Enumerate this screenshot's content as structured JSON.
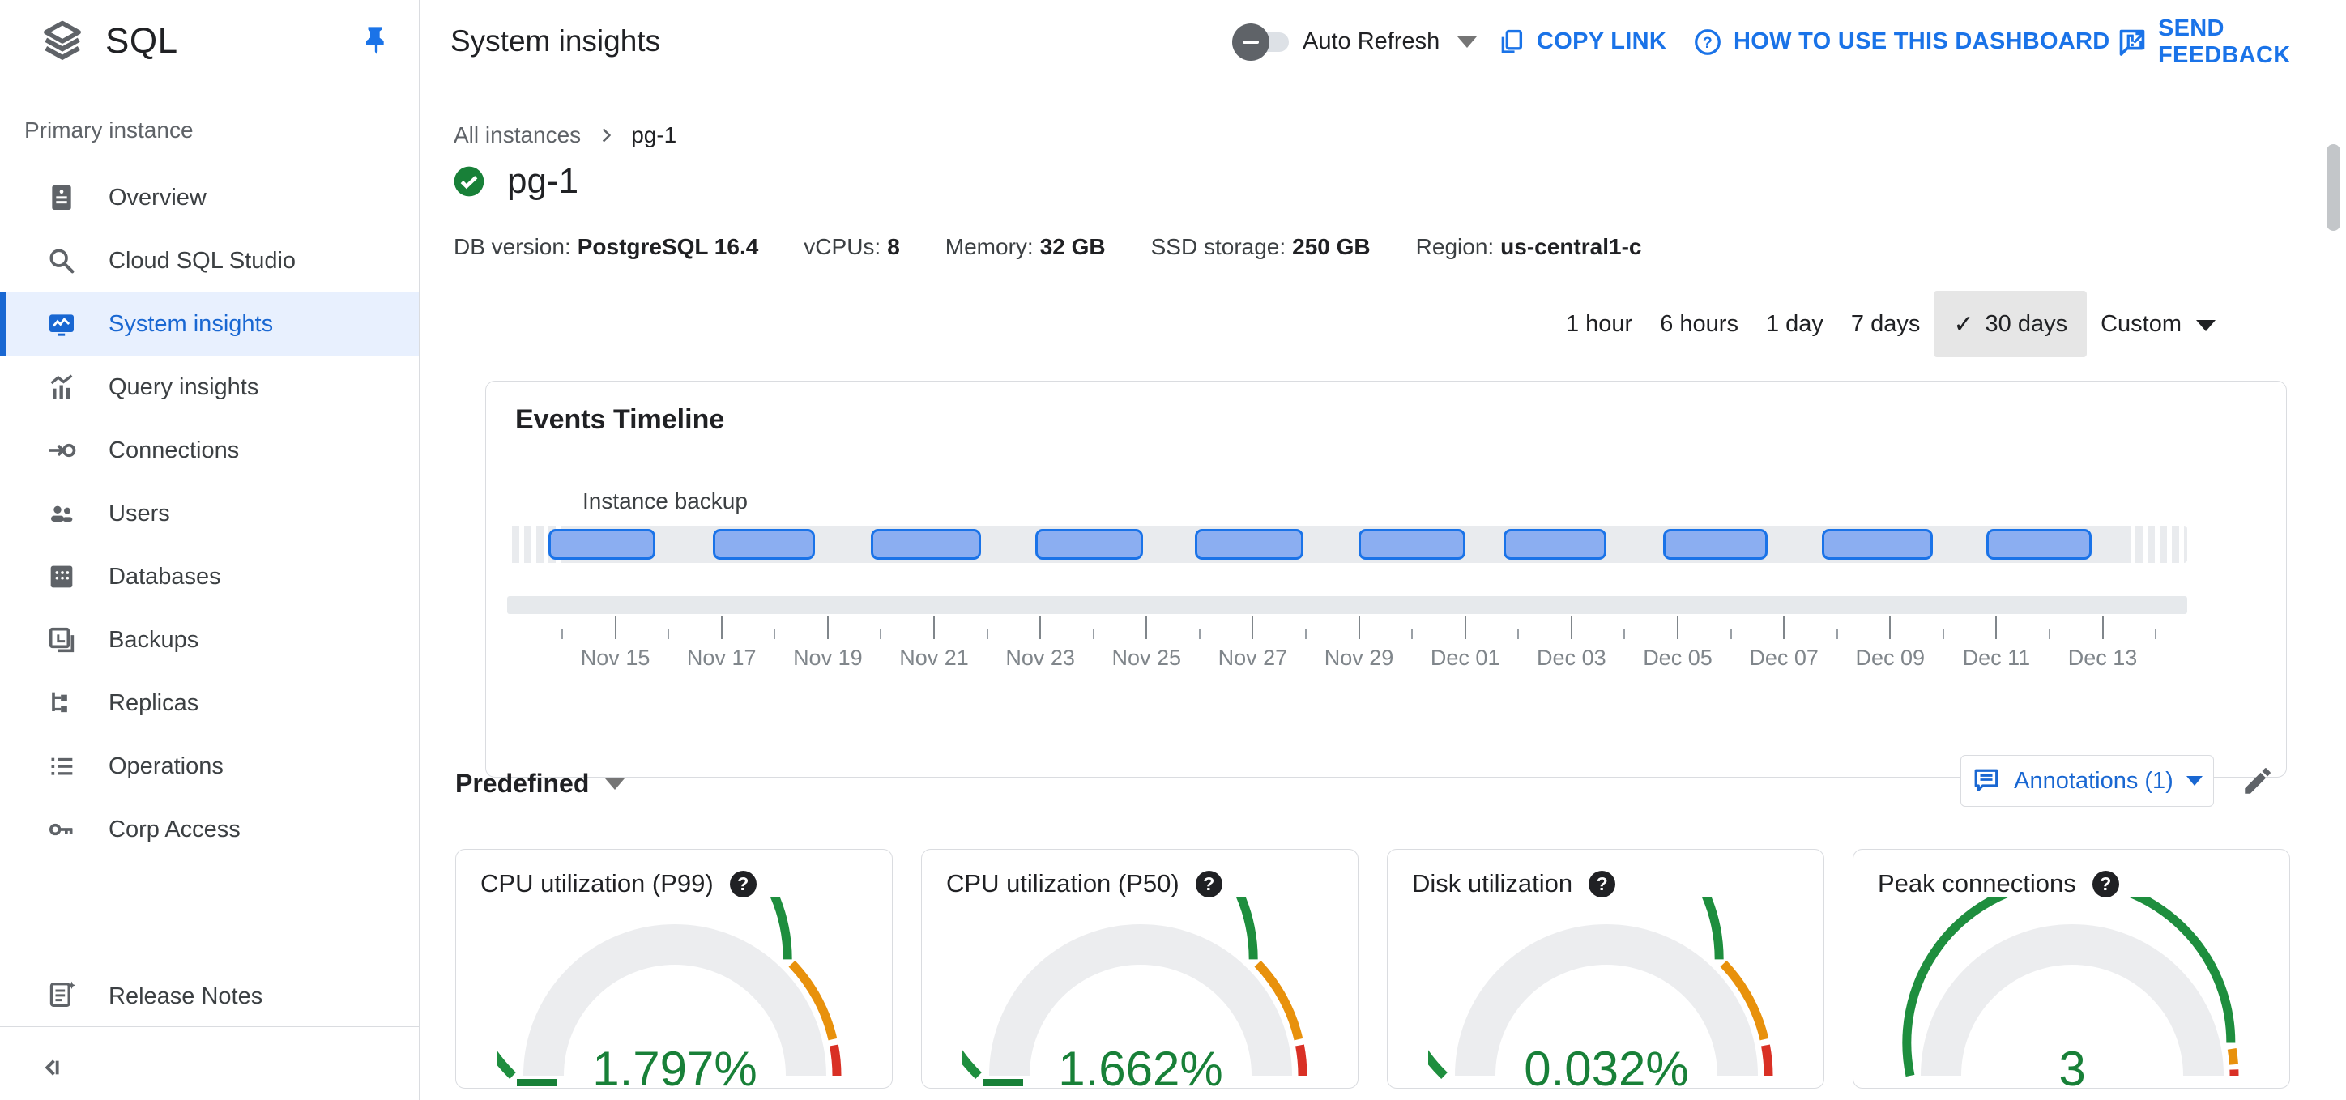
{
  "colors": {
    "accent_blue": "#1967D2",
    "link_blue": "#1A73E8",
    "green_text": "#188038",
    "gauge_segment_colors": [
      "#1E8E3E",
      "#E8910C",
      "#D93025"
    ],
    "gauge_band": "#ECEDEF",
    "bar_fill": "#8BAEF1",
    "bar_border": "#1A73E8",
    "selected_bg": "#E8F0FE"
  },
  "header": {
    "logo_text": "SQL",
    "title": "System insights",
    "auto_refresh_label": "Auto Refresh",
    "copy_link_label": "COPY LINK",
    "how_to_label": "HOW TO USE THIS DASHBOARD",
    "send_feedback_label": "SEND FEEDBACK"
  },
  "sidebar": {
    "section_label": "Primary instance",
    "items": [
      {
        "label": "Overview",
        "icon": "overview",
        "selected": false
      },
      {
        "label": "Cloud SQL Studio",
        "icon": "search",
        "selected": false
      },
      {
        "label": "System insights",
        "icon": "system-insights",
        "selected": true
      },
      {
        "label": "Query insights",
        "icon": "query-insights",
        "selected": false
      },
      {
        "label": "Connections",
        "icon": "connections",
        "selected": false
      },
      {
        "label": "Users",
        "icon": "users",
        "selected": false
      },
      {
        "label": "Databases",
        "icon": "databases",
        "selected": false
      },
      {
        "label": "Backups",
        "icon": "backups",
        "selected": false
      },
      {
        "label": "Replicas",
        "icon": "replicas",
        "selected": false
      },
      {
        "label": "Operations",
        "icon": "operations",
        "selected": false
      },
      {
        "label": "Corp Access",
        "icon": "corp-access",
        "selected": false
      }
    ],
    "release_notes_label": "Release Notes"
  },
  "breadcrumb": {
    "root": "All instances",
    "current": "pg-1"
  },
  "instance": {
    "name": "pg-1",
    "status": "healthy",
    "meta": [
      {
        "label": "DB version:",
        "value": "PostgreSQL 16.4"
      },
      {
        "label": "vCPUs:",
        "value": "8"
      },
      {
        "label": "Memory:",
        "value": "32 GB"
      },
      {
        "label": "SSD storage:",
        "value": "250 GB"
      },
      {
        "label": "Region:",
        "value": "us-central1-c"
      }
    ]
  },
  "time_range": {
    "selected": "30 days",
    "check_glyph": "✓",
    "options": [
      {
        "label": "1 hour"
      },
      {
        "label": "6 hours"
      },
      {
        "label": "1 day"
      },
      {
        "label": "7 days"
      },
      {
        "label": "30 days",
        "selected": true
      },
      {
        "label": "Custom",
        "caret": true
      }
    ]
  },
  "events_timeline": {
    "title": "Events Timeline",
    "series_label": "Instance backup",
    "bars": {
      "lefts": [
        77,
        280,
        475,
        678,
        875,
        1077,
        1256,
        1453,
        1649,
        1852
      ],
      "widths": [
        132,
        126,
        136,
        133,
        134,
        132,
        127,
        129,
        137,
        130
      ]
    },
    "axis": {
      "tick_count": 31,
      "tick_step": 65.57,
      "first_label_index": 1,
      "labels": [
        "Nov 15",
        "Nov 17",
        "Nov 19",
        "Nov 21",
        "Nov 23",
        "Nov 25",
        "Nov 27",
        "Nov 29",
        "Dec 01",
        "Dec 03",
        "Dec 05",
        "Dec 07",
        "Dec 09",
        "Dec 11",
        "Dec 13"
      ]
    }
  },
  "metrics_bar": {
    "predefined_label": "Predefined",
    "annotations_label": "Annotations (1)"
  },
  "gauges": [
    {
      "title": "CPU utilization (P99)",
      "value": "1.797%",
      "segments": [
        [
          0,
          0.745
        ],
        [
          0.757,
          0.928
        ],
        [
          0.94,
          1
        ]
      ],
      "needle": true
    },
    {
      "title": "CPU utilization (P50)",
      "value": "1.662%",
      "segments": [
        [
          0,
          0.745
        ],
        [
          0.757,
          0.928
        ],
        [
          0.94,
          1
        ]
      ],
      "needle": true
    },
    {
      "title": "Disk utilization",
      "value": "0.032%",
      "segments": [
        [
          0,
          0.745
        ],
        [
          0.757,
          0.928
        ],
        [
          0.94,
          1
        ]
      ],
      "needle": false
    },
    {
      "title": "Peak connections",
      "value": "3",
      "segments": [
        [
          0,
          0.935
        ],
        [
          0.947,
          0.978
        ],
        [
          0.988,
          1
        ]
      ],
      "needle": false
    }
  ],
  "help_glyph": "?"
}
